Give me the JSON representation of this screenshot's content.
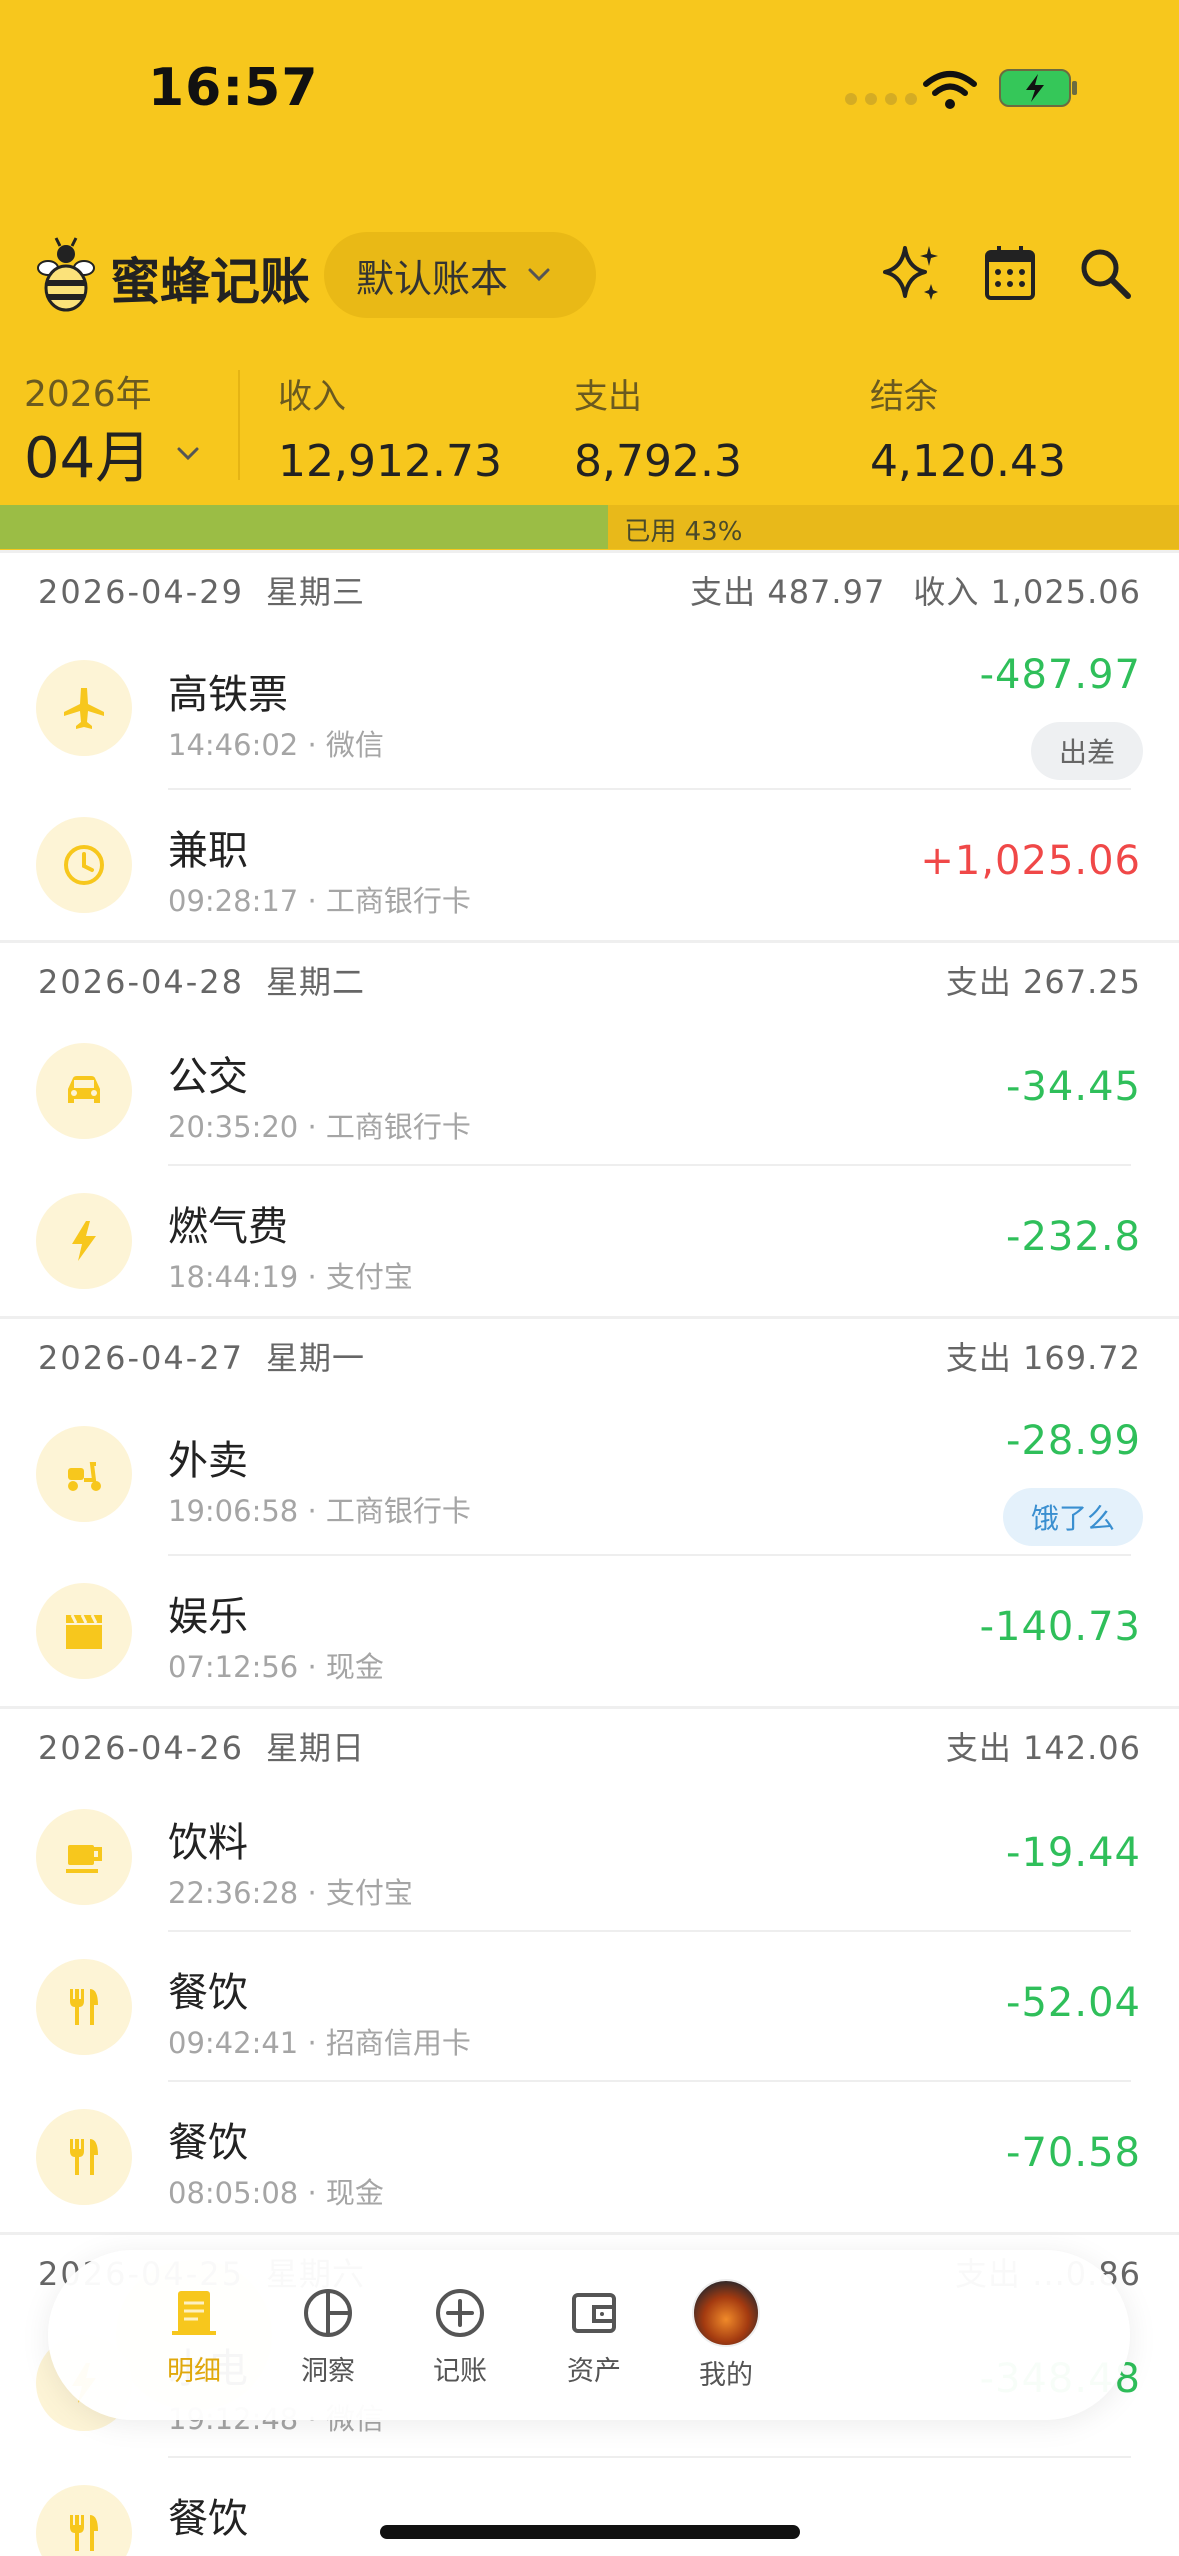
{
  "status": {
    "time": "16:57"
  },
  "app": {
    "name": "蜜蜂记账",
    "book": "默认账本"
  },
  "summary": {
    "year": "2026年",
    "month": "04月",
    "income_label": "收入",
    "income": "12,912.73",
    "expense_label": "支出",
    "expense": "8,792.3",
    "balance_label": "结余",
    "balance": "4,120.43",
    "used_text": "已用 43%",
    "used_fraction": 0.43
  },
  "days": [
    {
      "date": "2026-04-29",
      "weekday": "星期三",
      "expense": "支出 487.97",
      "income": "收入 1,025.06",
      "items": [
        {
          "icon": "airplane-icon",
          "name": "高铁票",
          "meta": "14:46:02 · 微信",
          "amount": "-487.97",
          "type": "out",
          "tag": "出差",
          "tag_style": "grey"
        },
        {
          "icon": "clock-icon",
          "name": "兼职",
          "meta": "09:28:17 · 工商银行卡",
          "amount": "+1,025.06",
          "type": "in"
        }
      ]
    },
    {
      "date": "2026-04-28",
      "weekday": "星期二",
      "expense": "支出 267.25",
      "items": [
        {
          "icon": "car-icon",
          "name": "公交",
          "meta": "20:35:20 · 工商银行卡",
          "amount": "-34.45",
          "type": "out"
        },
        {
          "icon": "lightning-icon",
          "name": "燃气费",
          "meta": "18:44:19 · 支付宝",
          "amount": "-232.8",
          "type": "out"
        }
      ]
    },
    {
      "date": "2026-04-27",
      "weekday": "星期一",
      "expense": "支出 169.72",
      "items": [
        {
          "icon": "scooter-icon",
          "name": "外卖",
          "meta": "19:06:58 · 工商银行卡",
          "amount": "-28.99",
          "type": "out",
          "tag": "饿了么",
          "tag_style": "blue"
        },
        {
          "icon": "clapperboard-icon",
          "name": "娱乐",
          "meta": "07:12:56 · 现金",
          "amount": "-140.73",
          "type": "out"
        }
      ]
    },
    {
      "date": "2026-04-26",
      "weekday": "星期日",
      "expense": "支出 142.06",
      "items": [
        {
          "icon": "coffee-icon",
          "name": "饮料",
          "meta": "22:36:28 · 支付宝",
          "amount": "-19.44",
          "type": "out"
        },
        {
          "icon": "fork-knife-icon",
          "name": "餐饮",
          "meta": "09:42:41 · 招商信用卡",
          "amount": "-52.04",
          "type": "out"
        },
        {
          "icon": "fork-knife-icon",
          "name": "餐饮",
          "meta": "08:05:08 · 现金",
          "amount": "-70.58",
          "type": "out"
        }
      ]
    },
    {
      "date": "2026-04-25",
      "weekday": "星期六",
      "expense": "支出 ...0.86",
      "items": [
        {
          "icon": "lightning-icon",
          "name": "水电",
          "meta": "19:12:48 · 微信",
          "amount": "-348.48",
          "type": "out"
        },
        {
          "icon": "fork-knife-icon",
          "name": "餐饮",
          "meta": "",
          "amount": "",
          "type": "out"
        }
      ]
    }
  ],
  "nav": [
    {
      "icon": "notebook-icon",
      "label": "明细",
      "active": true
    },
    {
      "icon": "pie-chart-icon",
      "label": "洞察"
    },
    {
      "icon": "plus-circle-icon",
      "label": "记账"
    },
    {
      "icon": "wallet-icon",
      "label": "资产"
    },
    {
      "icon": "avatar",
      "label": "我的"
    }
  ],
  "colors": {
    "brand": "#f7c71d",
    "expense": "#2fbf5a",
    "income": "#f04848",
    "progress": "#9bbd45"
  }
}
